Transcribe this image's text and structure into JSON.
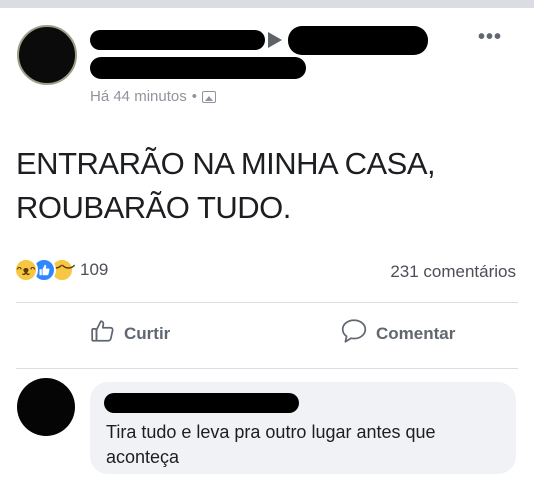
{
  "post": {
    "timestamp": "Há 44 minutos",
    "separator": "•",
    "text_line1": "ENTRARÃO NA MINHA CASA,",
    "text_line2": "ROUBARÃO TUDO.",
    "reactions_count": "109",
    "comments_count": "231 comentários"
  },
  "actions": {
    "like_label": "Curtir",
    "comment_label": "Comentar"
  },
  "comment": {
    "text": "Tira tudo e leva pra outro lugar antes que aconteça"
  },
  "icons": {
    "more": "more-options-icon",
    "privacy": "photo-icon",
    "like": "thumbs-up-icon",
    "comment": "speech-bubble-icon",
    "reactions": [
      "haha-emoji-icon",
      "like-emoji-icon",
      "sad-emoji-icon"
    ]
  },
  "colors": {
    "like_blue": "#2d88ff",
    "emoji_yellow": "#f7c743",
    "meta_gray": "#90949c",
    "bubble_bg": "#f0f2f5"
  }
}
